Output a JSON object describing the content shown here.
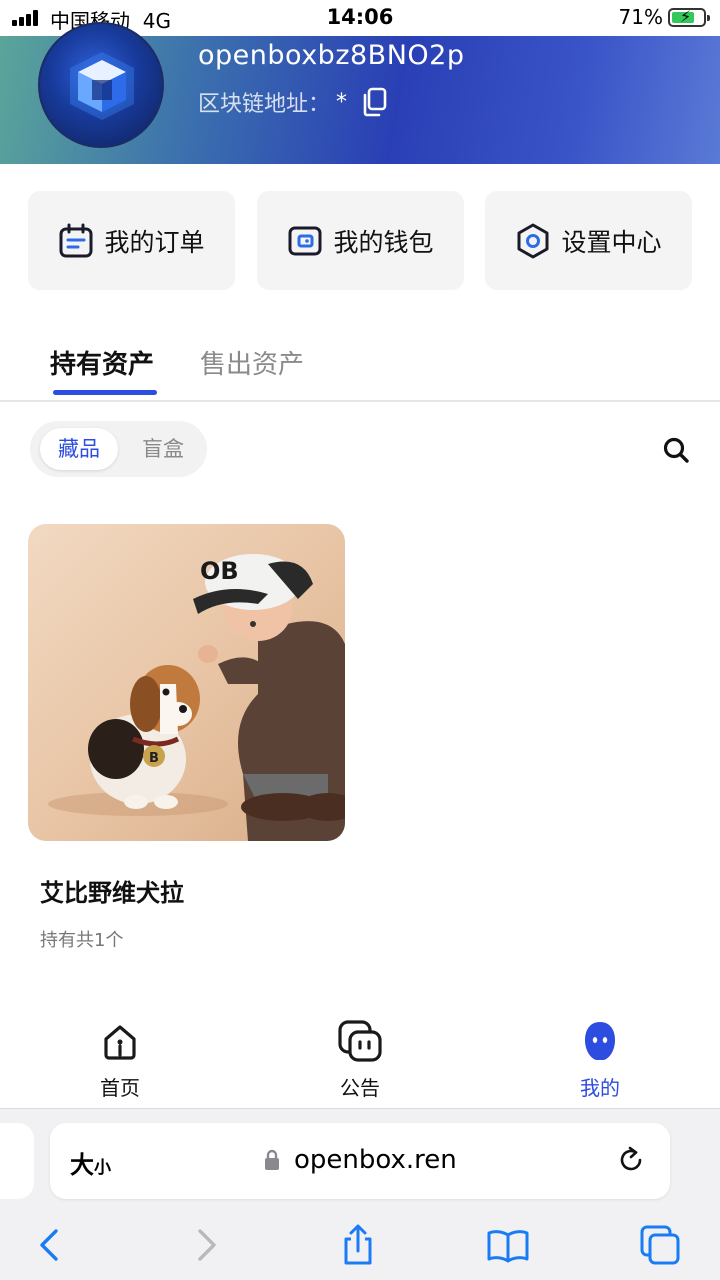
{
  "status_bar": {
    "carrier": "中国移动",
    "network": "4G",
    "time": "14:06",
    "battery": "71%"
  },
  "profile": {
    "username": "openboxbz8BNO2p",
    "address_label": "区块链地址：",
    "address_value": "*"
  },
  "quick_actions": [
    {
      "label": "我的订单",
      "icon": "order-icon"
    },
    {
      "label": "我的钱包",
      "icon": "wallet-icon"
    },
    {
      "label": "设置中心",
      "icon": "settings-icon"
    }
  ],
  "tabs": [
    {
      "label": "持有资产",
      "active": true
    },
    {
      "label": "售出资产",
      "active": false
    }
  ],
  "segment": [
    {
      "label": "藏品",
      "active": true
    },
    {
      "label": "盲盒",
      "active": false
    }
  ],
  "items": [
    {
      "title": "艾比野维犬拉",
      "subtitle": "持有共1个",
      "image_text": "OB",
      "tag_text": "B"
    }
  ],
  "bottom_nav": [
    {
      "label": "首页",
      "icon": "home-icon",
      "active": false
    },
    {
      "label": "公告",
      "icon": "announcement-icon",
      "active": false
    },
    {
      "label": "我的",
      "icon": "profile-icon",
      "active": true
    }
  ],
  "browser": {
    "text_size_big": "大",
    "text_size_small": "小",
    "url": "openbox.ren"
  },
  "colors": {
    "accent": "#2d4de0",
    "banner_start": "#5aa59a",
    "banner_end": "#3a55c8",
    "ios_blue": "#1a7cf5"
  }
}
